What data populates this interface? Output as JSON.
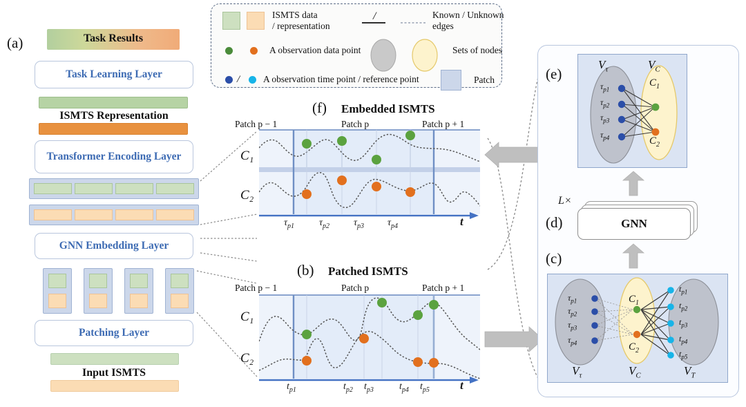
{
  "figure": {
    "panel_labels": {
      "a": "(a)",
      "b": "(b)",
      "c": "(c)",
      "d": "(d)",
      "e": "(e)",
      "f": "(f)"
    }
  },
  "panel_a": {
    "task_results": "Task Results",
    "task_learning_layer": "Task Learning Layer",
    "ismts_representation": "ISMTS Representation",
    "transformer_encoding_layer": "Transformer Encoding Layer",
    "gnn_embedding_layer": "GNN Embedding Layer",
    "patching_layer": "Patching Layer",
    "input_ismts": "Input ISMTS",
    "token_row_count": 4,
    "patch_box_count": 4
  },
  "legend": {
    "items": [
      {
        "id": "ismts-data",
        "swatch_colors": [
          "#cde0c0",
          "#fbdcb4"
        ],
        "line1": "ISMTS data",
        "line2": "/ representation"
      },
      {
        "id": "known-unknown-edges",
        "line1": "Known / Unknown",
        "line2": "edges",
        "separator": "/"
      },
      {
        "id": "observation-data-point",
        "colors": [
          "#4a8b3a",
          "#e2701e"
        ],
        "label": "A observation data point"
      },
      {
        "id": "sets-of-nodes",
        "label": "Sets of nodes",
        "ellipse_colors": [
          "#c9c9c9",
          "#fdf3cd"
        ]
      },
      {
        "id": "observation-time-point",
        "colors": [
          "#2b4ea8",
          "#17b4e8"
        ],
        "separator": "/",
        "label": "A observation time point / reference point"
      },
      {
        "id": "patch",
        "label": "Patch",
        "swatch_color": "#ccd7ea"
      }
    ]
  },
  "chart_data": [
    {
      "id": "panel-f",
      "type": "line",
      "title": "Embedded ISMTS",
      "panel": "(f)",
      "xlabel": "t",
      "series_labels": [
        "C₁",
        "C₂"
      ],
      "patch_labels": [
        "Patch p − 1",
        "Patch p",
        "Patch p + 1"
      ],
      "tick_labels": [
        "τ",
        "τ",
        "τ",
        "τ"
      ],
      "tick_subscripts": [
        "p1",
        "p2",
        "p3",
        "p4"
      ],
      "tick_x": [
        0.215,
        0.375,
        0.53,
        0.685
      ],
      "series": [
        {
          "name": "C1",
          "color": "#5ba23f",
          "points_x": [
            0.215,
            0.375,
            0.53,
            0.685
          ],
          "points_y": [
            0.61,
            0.7,
            0.49,
            0.91
          ]
        },
        {
          "name": "C2",
          "color": "#e2701e",
          "points_x": [
            0.215,
            0.375,
            0.53,
            0.685
          ],
          "points_y": [
            0.3,
            0.49,
            0.36,
            0.3
          ]
        }
      ],
      "patch_boundaries_x": [
        0.155,
        0.79
      ]
    },
    {
      "id": "panel-b",
      "type": "line",
      "title": "Patched ISMTS",
      "panel": "(b)",
      "xlabel": "t",
      "series_labels": [
        "C₁",
        "C₂"
      ],
      "patch_labels": [
        "Patch p − 1",
        "Patch p",
        "Patch p + 1"
      ],
      "tick_labels": [
        "t",
        "t",
        "t",
        "t",
        "t"
      ],
      "tick_subscripts": [
        "p1",
        "p2",
        "p3",
        "p4",
        "p5"
      ],
      "tick_x": [
        0.215,
        0.465,
        0.545,
        0.705,
        0.775
      ],
      "series": [
        {
          "name": "C1",
          "color": "#5ba23f",
          "points_x": [
            0.215,
            0.545,
            0.705,
            0.775
          ],
          "points_y": [
            0.55,
            0.88,
            0.73,
            0.86
          ]
        },
        {
          "name": "C2",
          "color": "#e2701e",
          "points_x": [
            0.215,
            0.465,
            0.705,
            0.775
          ],
          "points_y": [
            0.22,
            0.5,
            0.22,
            0.22
          ]
        }
      ],
      "patch_boundaries_x": [
        0.155,
        0.79
      ]
    }
  ],
  "panel_e": {
    "label": "(e)",
    "set_left": "V",
    "set_left_sub": "τ",
    "set_right": "V",
    "set_right_sub": "C",
    "left_nodes": [
      {
        "label": "τ",
        "sub": "p1",
        "color": "#2b4ea8"
      },
      {
        "label": "τ",
        "sub": "p2",
        "color": "#2b4ea8"
      },
      {
        "label": "τ",
        "sub": "p3",
        "color": "#2b4ea8"
      },
      {
        "label": "τ",
        "sub": "p4",
        "color": "#2b4ea8"
      }
    ],
    "right_nodes": [
      {
        "label": "C",
        "sub": "1",
        "color": "#5ba23f"
      },
      {
        "label": "C",
        "sub": "2",
        "color": "#e2701e"
      }
    ]
  },
  "panel_d": {
    "label": "(d)",
    "repeat": "L×",
    "name": "GNN"
  },
  "panel_c": {
    "label": "(c)",
    "sets": [
      {
        "name": "V",
        "sub": "τ"
      },
      {
        "name": "V",
        "sub": "C"
      },
      {
        "name": "V",
        "sub": "T"
      }
    ],
    "left_nodes": [
      {
        "label": "τ",
        "sub": "p1",
        "color": "#2b4ea8"
      },
      {
        "label": "τ",
        "sub": "p2",
        "color": "#2b4ea8"
      },
      {
        "label": "τ",
        "sub": "p3",
        "color": "#2b4ea8"
      },
      {
        "label": "τ",
        "sub": "p4",
        "color": "#2b4ea8"
      }
    ],
    "center_nodes": [
      {
        "label": "C",
        "sub": "1",
        "color": "#5ba23f"
      },
      {
        "label": "C",
        "sub": "2",
        "color": "#e2701e"
      }
    ],
    "right_nodes": [
      {
        "label": "t",
        "sub": "p1",
        "color": "#17b4e8"
      },
      {
        "label": "t",
        "sub": "p2",
        "color": "#17b4e8"
      },
      {
        "label": "t",
        "sub": "p3",
        "color": "#17b4e8"
      },
      {
        "label": "t",
        "sub": "p4",
        "color": "#17b4e8"
      },
      {
        "label": "t",
        "sub": "p5",
        "color": "#17b4e8"
      }
    ]
  },
  "colors": {
    "green": "#5ba23f",
    "orange": "#e2701e",
    "blue_node": "#2b4ea8",
    "cyan_node": "#17b4e8",
    "panel_blue": "#3d6bb3",
    "patch_fill": "#ccd7ea",
    "axis_blue": "#4472c4",
    "arrow_grey": "#bfbfbf"
  }
}
